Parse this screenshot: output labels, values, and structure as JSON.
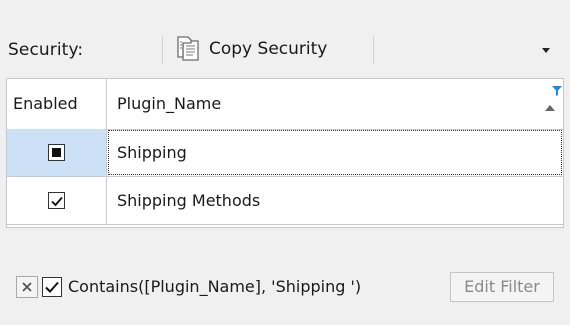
{
  "toolbar": {
    "security_label": "Security:",
    "copy_security_label": "Copy Security"
  },
  "grid": {
    "columns": [
      "Enabled",
      "Plugin_Name"
    ],
    "rows": [
      {
        "enabled": "indeterminate",
        "plugin_name": "Shipping",
        "selected": true
      },
      {
        "enabled": "checked",
        "plugin_name": "Shipping Methods",
        "selected": false
      }
    ]
  },
  "filter": {
    "enabled": true,
    "expression": "Contains([Plugin_Name], 'Shipping ')",
    "edit_label": "Edit Filter"
  },
  "colors": {
    "selection": "#cce1f5",
    "filter_icon": "#1e88e5",
    "background": "#f0f0f0"
  },
  "icons": [
    "copy-document-icon",
    "dropdown-arrow-icon",
    "sort-ascending-icon",
    "filter-funnel-icon",
    "close-x-icon",
    "checkmark-icon"
  ]
}
